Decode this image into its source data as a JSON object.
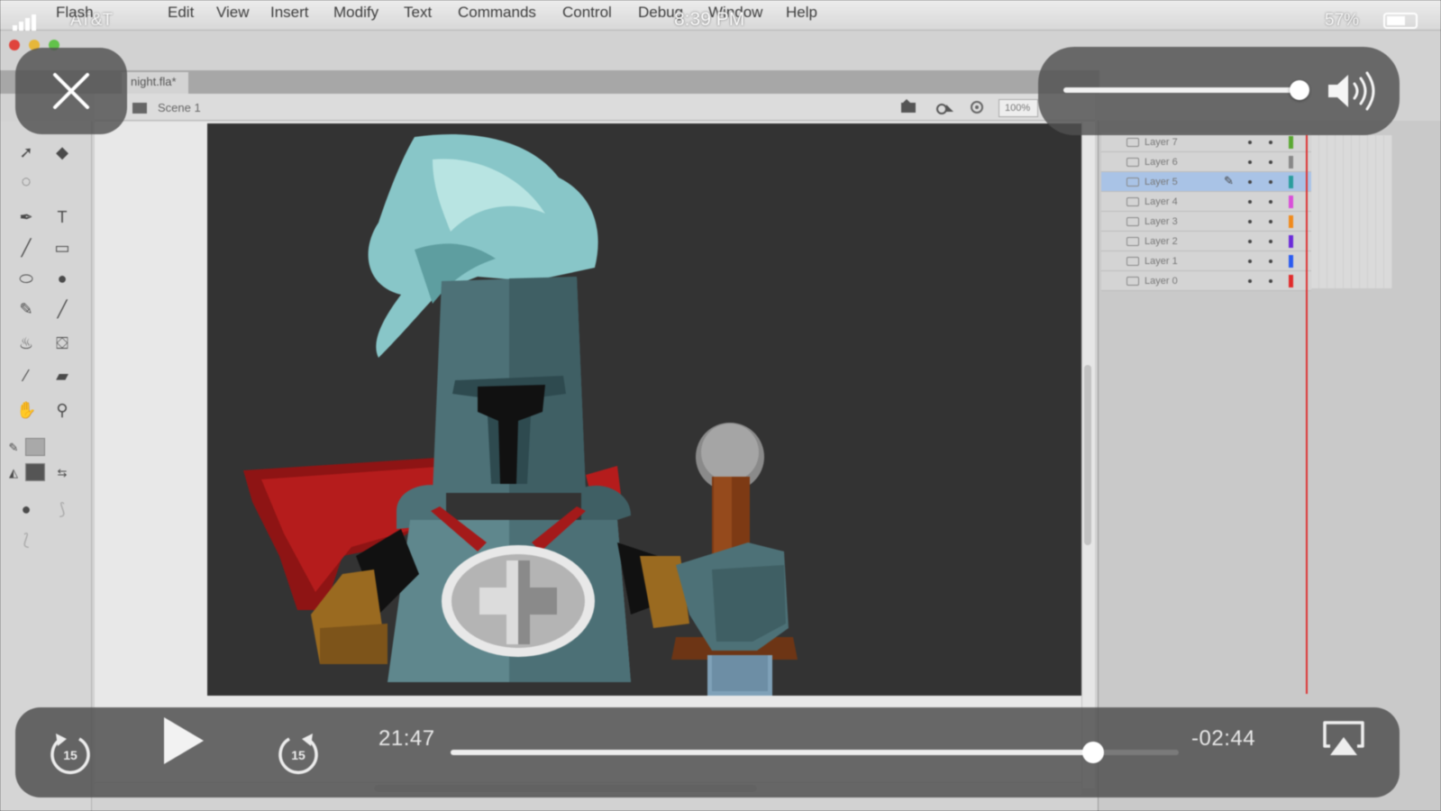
{
  "status_bar": {
    "carrier": "AT&T",
    "time": "8:39 PM",
    "battery": "57%"
  },
  "menubar": {
    "items": [
      "Flash",
      "Edit",
      "View",
      "Insert",
      "Modify",
      "Text",
      "Commands",
      "Control",
      "Debug",
      "Window",
      "Help"
    ]
  },
  "document": {
    "tab": "night.fla*",
    "scene": "Scene 1",
    "zoom": "100%"
  },
  "timeline": {
    "layers": [
      {
        "name": "Layer 7",
        "color": "#5aa832",
        "selected": false
      },
      {
        "name": "Layer 6",
        "color": "#888888",
        "selected": false
      },
      {
        "name": "Layer 5",
        "color": "#2a9d9d",
        "selected": true
      },
      {
        "name": "Layer 4",
        "color": "#d94fd9",
        "selected": false
      },
      {
        "name": "Layer 3",
        "color": "#f08a1c",
        "selected": false
      },
      {
        "name": "Layer 2",
        "color": "#6b2bd9",
        "selected": false
      },
      {
        "name": "Layer 1",
        "color": "#2b5bf0",
        "selected": false
      },
      {
        "name": "Layer 0",
        "color": "#e02b2b",
        "selected": false
      }
    ]
  },
  "player": {
    "elapsed": "21:47",
    "remaining": "-02:44",
    "progress_fraction": 0.882,
    "volume_fraction": 1.0,
    "skip_back_seconds": "15",
    "skip_forward_seconds": "15"
  },
  "icons": {
    "close": "close-icon",
    "volume": "speaker-icon",
    "airplay": "airplay-icon",
    "play": "play-icon"
  }
}
